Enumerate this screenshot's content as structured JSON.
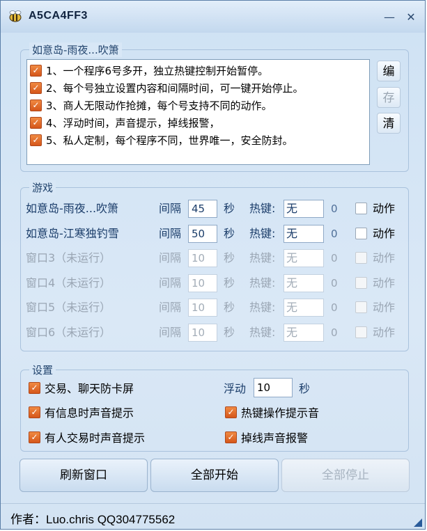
{
  "window": {
    "title": "A5CA4FF3",
    "minimize": "—",
    "close": "✕"
  },
  "notes": {
    "title": "如意岛-雨夜...吹箫",
    "items": [
      "1、一个程序6号多开，独立热键控制开始暂停。",
      "2、每个号独立设置内容和间隔时间，可一键开始停止。",
      "3、商人无限动作抢摊，每个号支持不同的动作。",
      "4、浮动时间，声音提示，掉线报警，",
      "5、私人定制，每个程序不同，世界唯一，安全防封。"
    ],
    "buttons": {
      "edit": "编",
      "save": "存",
      "clear": "清"
    }
  },
  "games": {
    "title": "游戏",
    "interval_label": "间隔",
    "sec_label": "秒",
    "hotkey_label": "热键:",
    "action_label": "动作",
    "rows": [
      {
        "name": "如意岛-雨夜...吹箫",
        "interval": "45",
        "hotkey": "无",
        "count": "0",
        "active": true
      },
      {
        "name": "如意岛-江寒独钓雪",
        "interval": "50",
        "hotkey": "无",
        "count": "0",
        "active": true
      },
      {
        "name": "窗口3（未运行）",
        "interval": "10",
        "hotkey": "无",
        "count": "0",
        "active": false
      },
      {
        "name": "窗口4（未运行）",
        "interval": "10",
        "hotkey": "无",
        "count": "0",
        "active": false
      },
      {
        "name": "窗口5（未运行）",
        "interval": "10",
        "hotkey": "无",
        "count": "0",
        "active": false
      },
      {
        "name": "窗口6（未运行）",
        "interval": "10",
        "hotkey": "无",
        "count": "0",
        "active": false
      }
    ]
  },
  "settings": {
    "title": "设置",
    "anti_freeze": "交易、聊天防卡屏",
    "float_label": "浮动",
    "float_value": "10",
    "float_unit": "秒",
    "msg_sound": "有信息时声音提示",
    "hotkey_sound": "热键操作提示音",
    "trade_sound": "有人交易时声音提示",
    "disconnect_alarm": "掉线声音报警"
  },
  "actions": {
    "refresh": "刷新窗口",
    "start_all": "全部开始",
    "stop_all": "全部停止"
  },
  "status": {
    "author": "作者：Luo.chris   QQ304775562"
  },
  "colors": {
    "accent_check": "#e06a2a",
    "title_blue": "#1b3d6a"
  }
}
